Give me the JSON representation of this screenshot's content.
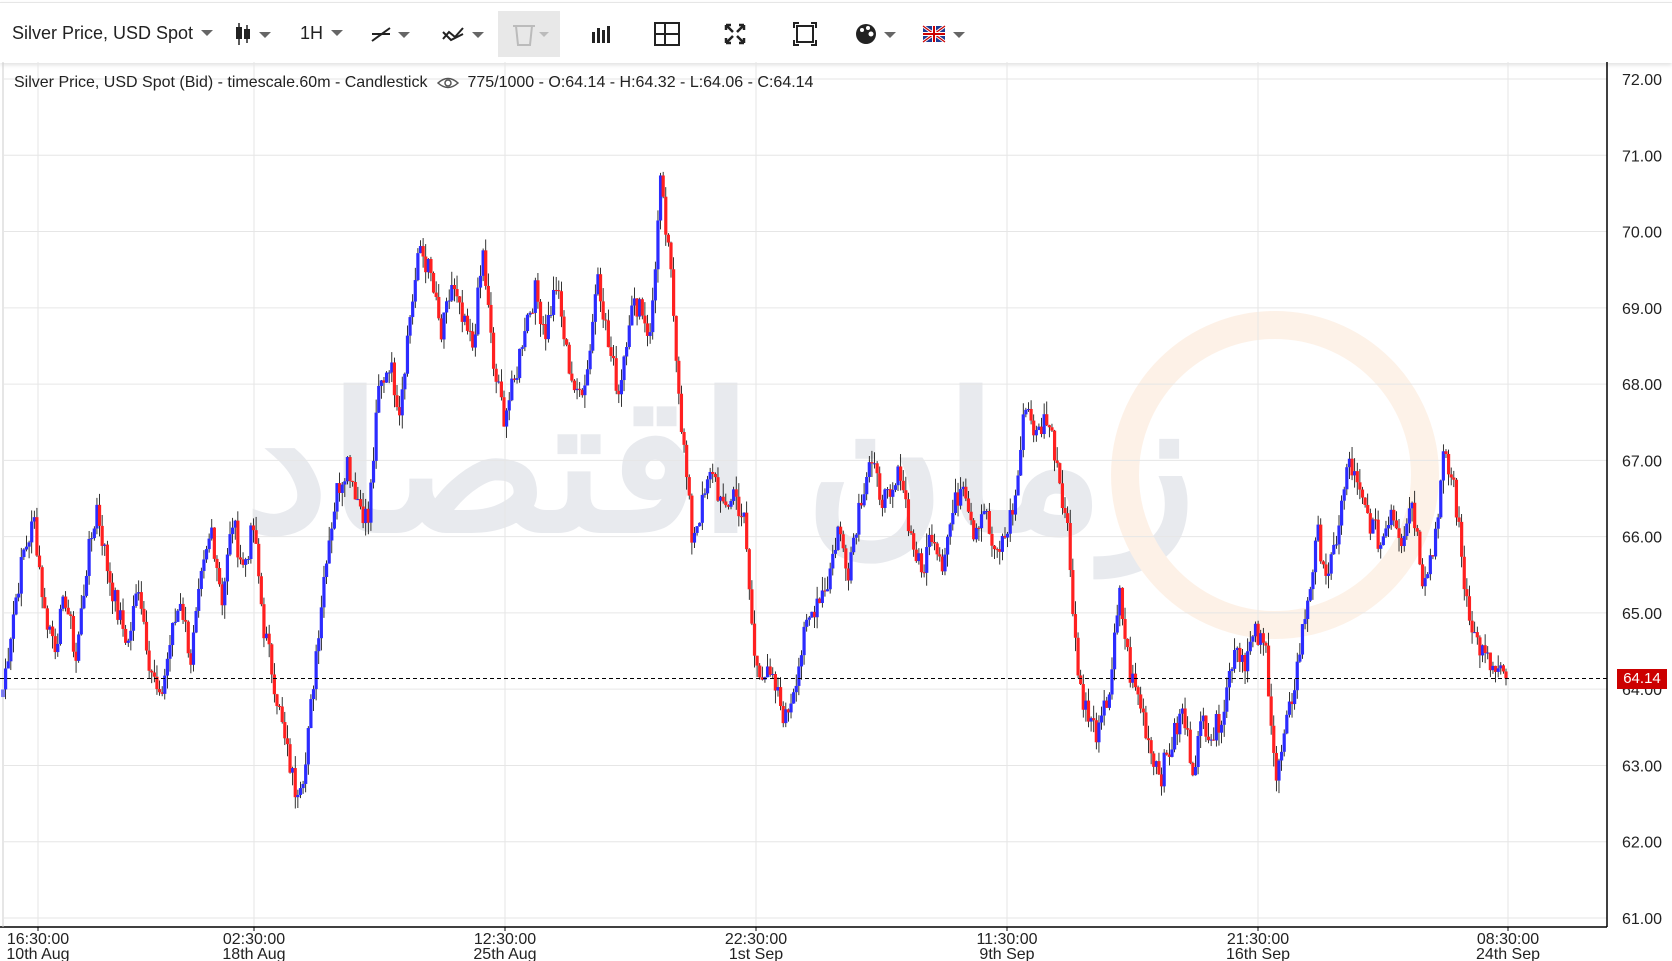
{
  "toolbar": {
    "symbol": "Silver Price, USD Spot",
    "interval": "1H",
    "icons": [
      "candlestick-icon",
      "line-tool-icon",
      "indicator-icon",
      "trash-icon",
      "bar-volume-icon",
      "crosshair-icon",
      "fullscreen-icon",
      "fit-screen-icon",
      "palette-icon",
      "uk-flag-icon"
    ]
  },
  "legend": {
    "title": "Silver Price, USD Spot (Bid) - timescale.60m - Candlestick",
    "ohlc": "775/1000 - O:64.14 - H:64.32 - L:64.06 - C:64.14"
  },
  "current_price_label": "64.14",
  "colors": {
    "up": "#2b2bff",
    "down": "#ff2020",
    "wick": "#000000",
    "grid": "#e6e6e6",
    "price_tag": "#cc0000"
  },
  "chart_data": {
    "type": "candlestick",
    "title": "Silver Price, USD Spot (Bid) - timescale.60m - Candlestick",
    "y_ticks": [
      "72.00",
      "71.00",
      "70.00",
      "69.00",
      "68.00",
      "67.00",
      "66.00",
      "65.00",
      "64.00",
      "63.00",
      "62.00",
      "61.00"
    ],
    "ylim": [
      61,
      72
    ],
    "x_ticks": [
      {
        "time": "16:30:00",
        "date": "10th Aug"
      },
      {
        "time": "02:30:00",
        "date": "18th Aug"
      },
      {
        "time": "12:30:00",
        "date": "25th Aug"
      },
      {
        "time": "22:30:00",
        "date": "1st Sep"
      },
      {
        "time": "11:30:00",
        "date": "9th Sep"
      },
      {
        "time": "21:30:00",
        "date": "16th Sep"
      },
      {
        "time": "08:30:00",
        "date": "24th Sep"
      }
    ],
    "current_price": 64.14,
    "close_path": [
      [
        0,
        64.0
      ],
      [
        4,
        65.0
      ],
      [
        8,
        65.8
      ],
      [
        12,
        66.2
      ],
      [
        16,
        65.0
      ],
      [
        20,
        64.6
      ],
      [
        24,
        65.2
      ],
      [
        28,
        64.4
      ],
      [
        32,
        65.6
      ],
      [
        36,
        66.4
      ],
      [
        40,
        65.6
      ],
      [
        44,
        65.0
      ],
      [
        48,
        64.6
      ],
      [
        52,
        65.4
      ],
      [
        56,
        64.4
      ],
      [
        60,
        63.8
      ],
      [
        64,
        64.6
      ],
      [
        68,
        65.2
      ],
      [
        72,
        64.4
      ],
      [
        76,
        65.4
      ],
      [
        80,
        66.1
      ],
      [
        84,
        65.2
      ],
      [
        88,
        66.2
      ],
      [
        92,
        65.6
      ],
      [
        96,
        66.1
      ],
      [
        100,
        64.8
      ],
      [
        104,
        64.1
      ],
      [
        108,
        63.3
      ],
      [
        112,
        62.7
      ],
      [
        116,
        63.0
      ],
      [
        120,
        64.5
      ],
      [
        124,
        65.8
      ],
      [
        128,
        66.6
      ],
      [
        132,
        67.0
      ],
      [
        136,
        66.5
      ],
      [
        140,
        66.2
      ],
      [
        144,
        67.9
      ],
      [
        148,
        68.3
      ],
      [
        152,
        67.7
      ],
      [
        156,
        68.9
      ],
      [
        160,
        69.8
      ],
      [
        164,
        69.4
      ],
      [
        168,
        68.6
      ],
      [
        172,
        69.3
      ],
      [
        176,
        68.8
      ],
      [
        180,
        68.5
      ],
      [
        184,
        69.7
      ],
      [
        188,
        68.2
      ],
      [
        192,
        67.6
      ],
      [
        196,
        68.0
      ],
      [
        200,
        68.8
      ],
      [
        204,
        69.2
      ],
      [
        208,
        68.7
      ],
      [
        212,
        69.3
      ],
      [
        216,
        68.4
      ],
      [
        220,
        67.8
      ],
      [
        224,
        68.2
      ],
      [
        228,
        69.5
      ],
      [
        232,
        68.5
      ],
      [
        236,
        67.9
      ],
      [
        240,
        68.9
      ],
      [
        244,
        69.1
      ],
      [
        248,
        68.6
      ],
      [
        252,
        70.6
      ],
      [
        256,
        69.4
      ],
      [
        260,
        67.5
      ],
      [
        264,
        66.0
      ],
      [
        268,
        66.4
      ],
      [
        272,
        66.9
      ],
      [
        276,
        66.3
      ],
      [
        280,
        66.6
      ],
      [
        284,
        66.2
      ],
      [
        288,
        64.4
      ],
      [
        292,
        64.2
      ],
      [
        296,
        64.0
      ],
      [
        300,
        63.6
      ],
      [
        304,
        64.2
      ],
      [
        308,
        64.8
      ],
      [
        312,
        65.2
      ],
      [
        316,
        65.4
      ],
      [
        320,
        66.1
      ],
      [
        324,
        65.6
      ],
      [
        328,
        66.4
      ],
      [
        332,
        67.0
      ],
      [
        336,
        66.6
      ],
      [
        340,
        66.4
      ],
      [
        344,
        66.9
      ],
      [
        348,
        66.0
      ],
      [
        352,
        65.5
      ],
      [
        356,
        66.1
      ],
      [
        360,
        65.7
      ],
      [
        364,
        66.3
      ],
      [
        368,
        66.8
      ],
      [
        372,
        66.1
      ],
      [
        376,
        66.4
      ],
      [
        380,
        65.7
      ],
      [
        384,
        66.0
      ],
      [
        388,
        66.5
      ],
      [
        392,
        67.8
      ],
      [
        396,
        67.3
      ],
      [
        400,
        67.6
      ],
      [
        404,
        67.0
      ],
      [
        408,
        66.1
      ],
      [
        412,
        64.2
      ],
      [
        416,
        63.6
      ],
      [
        420,
        63.4
      ],
      [
        424,
        64.0
      ],
      [
        428,
        65.2
      ],
      [
        432,
        64.2
      ],
      [
        436,
        63.8
      ],
      [
        440,
        63.2
      ],
      [
        444,
        62.9
      ],
      [
        448,
        63.3
      ],
      [
        452,
        63.7
      ],
      [
        456,
        63.0
      ],
      [
        460,
        63.6
      ],
      [
        464,
        63.4
      ],
      [
        468,
        63.8
      ],
      [
        472,
        64.6
      ],
      [
        476,
        64.4
      ],
      [
        480,
        64.7
      ],
      [
        484,
        64.5
      ],
      [
        488,
        62.8
      ],
      [
        492,
        63.5
      ],
      [
        496,
        64.3
      ],
      [
        500,
        65.2
      ],
      [
        504,
        66.0
      ],
      [
        508,
        65.4
      ],
      [
        512,
        66.2
      ],
      [
        516,
        67.0
      ],
      [
        520,
        66.5
      ],
      [
        524,
        66.2
      ],
      [
        528,
        65.9
      ],
      [
        532,
        66.4
      ],
      [
        536,
        66.0
      ],
      [
        540,
        66.5
      ],
      [
        544,
        65.5
      ],
      [
        548,
        65.8
      ],
      [
        552,
        67.0
      ],
      [
        556,
        66.7
      ],
      [
        560,
        65.4
      ],
      [
        564,
        64.7
      ],
      [
        568,
        64.4
      ],
      [
        572,
        64.2
      ],
      [
        576,
        64.14
      ]
    ]
  }
}
